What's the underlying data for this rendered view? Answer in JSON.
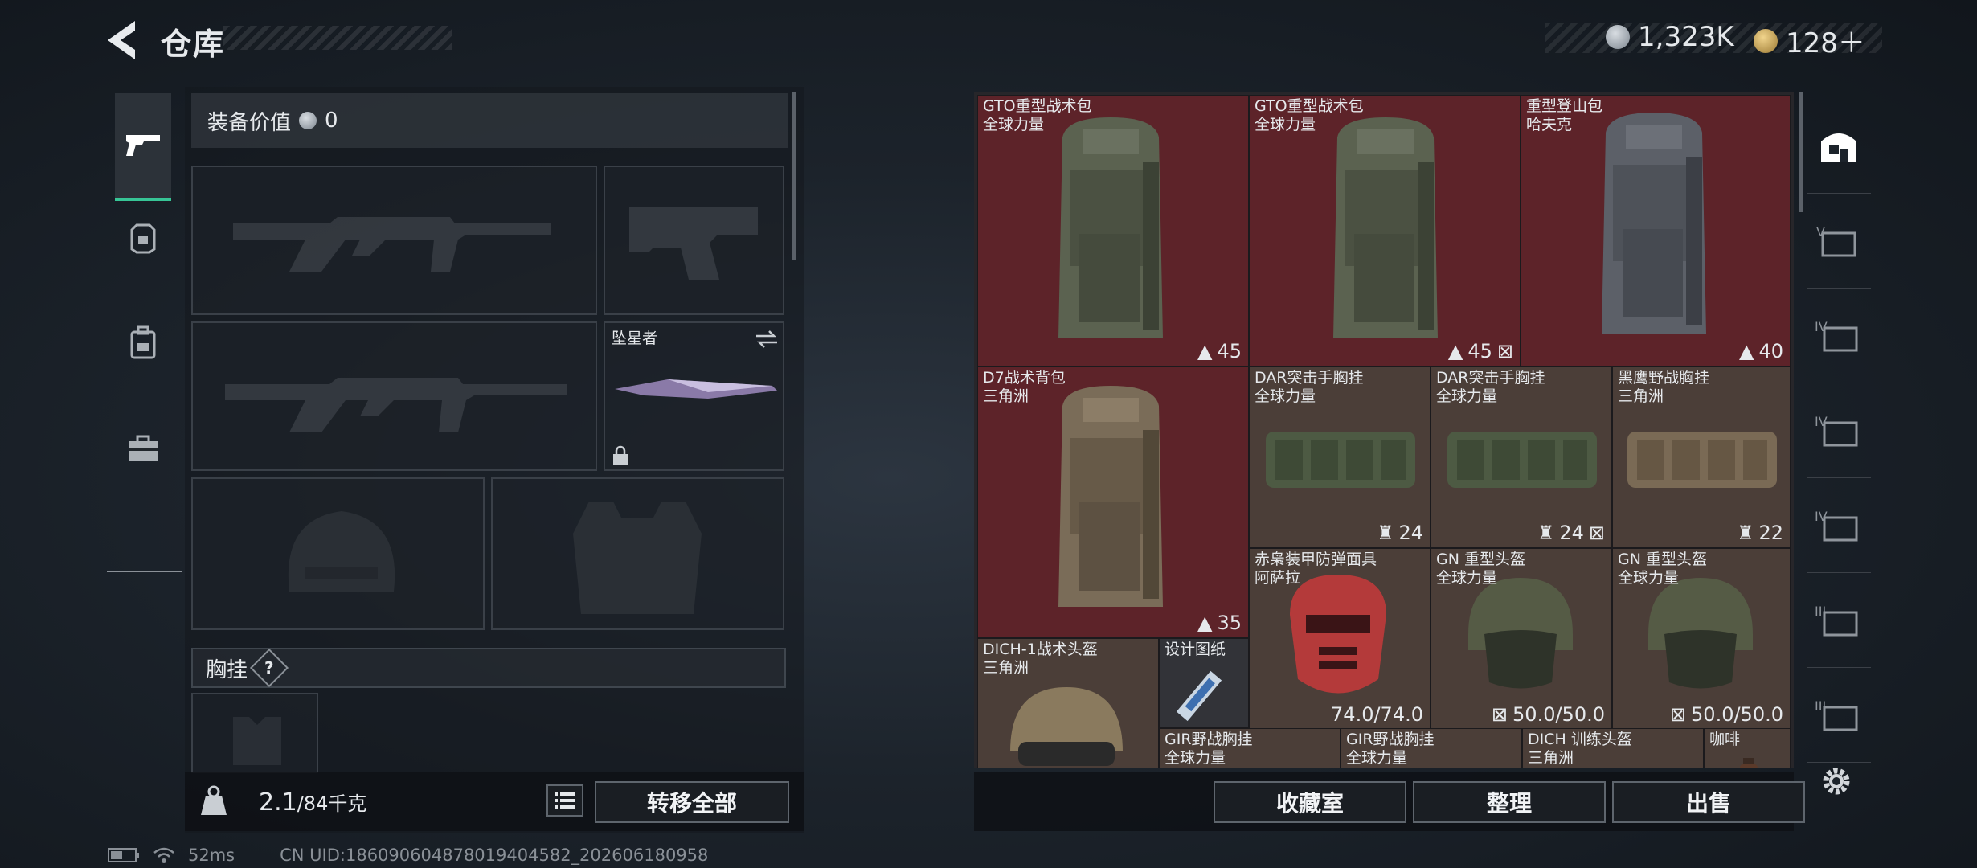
{
  "header": {
    "title": "仓库"
  },
  "currency": {
    "silver": "1,323K",
    "premium": "128＋"
  },
  "equip": {
    "value_label": "装备价值",
    "value": "0"
  },
  "melee": {
    "name": "坠星者"
  },
  "chest_rig": {
    "label": "胸挂",
    "help": "?"
  },
  "capacity": {
    "current": "2.1",
    "max": "/84千克"
  },
  "buttons": {
    "transfer_all": "转移全部",
    "collection": "收藏室",
    "organize": "整理",
    "sell": "出售"
  },
  "status": {
    "ping": "52ms",
    "uid": "CN UID:1860906048780194045​82_202606180958"
  },
  "items": [
    {
      "name": "GTO重型战术包",
      "source": "全球力量",
      "stat": "45",
      "stat_icon": "backpack-capacity-icon"
    },
    {
      "name": "GTO重型战术包",
      "source": "全球力量",
      "stat": "45",
      "stat_icon": "backpack-capacity-icon"
    },
    {
      "name": "重型登山包",
      "source": "哈夫克",
      "stat": "40",
      "stat_icon": "backpack-capacity-icon"
    },
    {
      "name": "D7战术背包",
      "source": "三角洲",
      "stat": "35",
      "stat_icon": "backpack-capacity-icon"
    },
    {
      "name": "DAR突击手胸挂",
      "source": "全球力量",
      "stat": "24",
      "stat_icon": "rig-capacity-icon"
    },
    {
      "name": "DAR突击手胸挂",
      "source": "全球力量",
      "stat": "24",
      "stat_icon": "rig-capacity-icon"
    },
    {
      "name": "黑鹰野战胸挂",
      "source": "三角洲",
      "stat": "22",
      "stat_icon": "rig-capacity-icon"
    },
    {
      "name": "赤枭装甲防弹面具",
      "source": "阿萨拉",
      "stat": "74.0/74.0",
      "stat_icon": "durability-icon"
    },
    {
      "name": "GN 重型头盔",
      "source": "全球力量",
      "stat": "50.0/50.0",
      "stat_icon": "durability-icon"
    },
    {
      "name": "GN 重型头盔",
      "source": "全球力量",
      "stat": "50.0/50.0",
      "stat_icon": "durability-icon"
    },
    {
      "name": "DICH-1战术头盔",
      "source": "三角洲",
      "stat": "",
      "stat_icon": ""
    },
    {
      "name": "设计图纸",
      "source": "",
      "stat": "",
      "stat_icon": ""
    },
    {
      "name": "GIR野战胸挂",
      "source": "全球力量",
      "stat": "",
      "stat_icon": ""
    },
    {
      "name": "GIR野战胸挂",
      "source": "全球力量",
      "stat": "",
      "stat_icon": ""
    },
    {
      "name": "DICH 训练头盔",
      "source": "三角洲",
      "stat": "",
      "stat_icon": ""
    },
    {
      "name": "咖啡",
      "source": "",
      "stat": "",
      "stat_icon": ""
    }
  ],
  "right_nav": [
    "warehouse-icon",
    "tier-v-icon",
    "tier-iv-icon",
    "tier-iv-icon",
    "tier-iv-icon",
    "tier-iii-icon",
    "tier-iii-icon"
  ],
  "colors": {
    "accent": "#37c596",
    "cell_red": "#5d2329",
    "cell_brown": "#4b3e38"
  }
}
